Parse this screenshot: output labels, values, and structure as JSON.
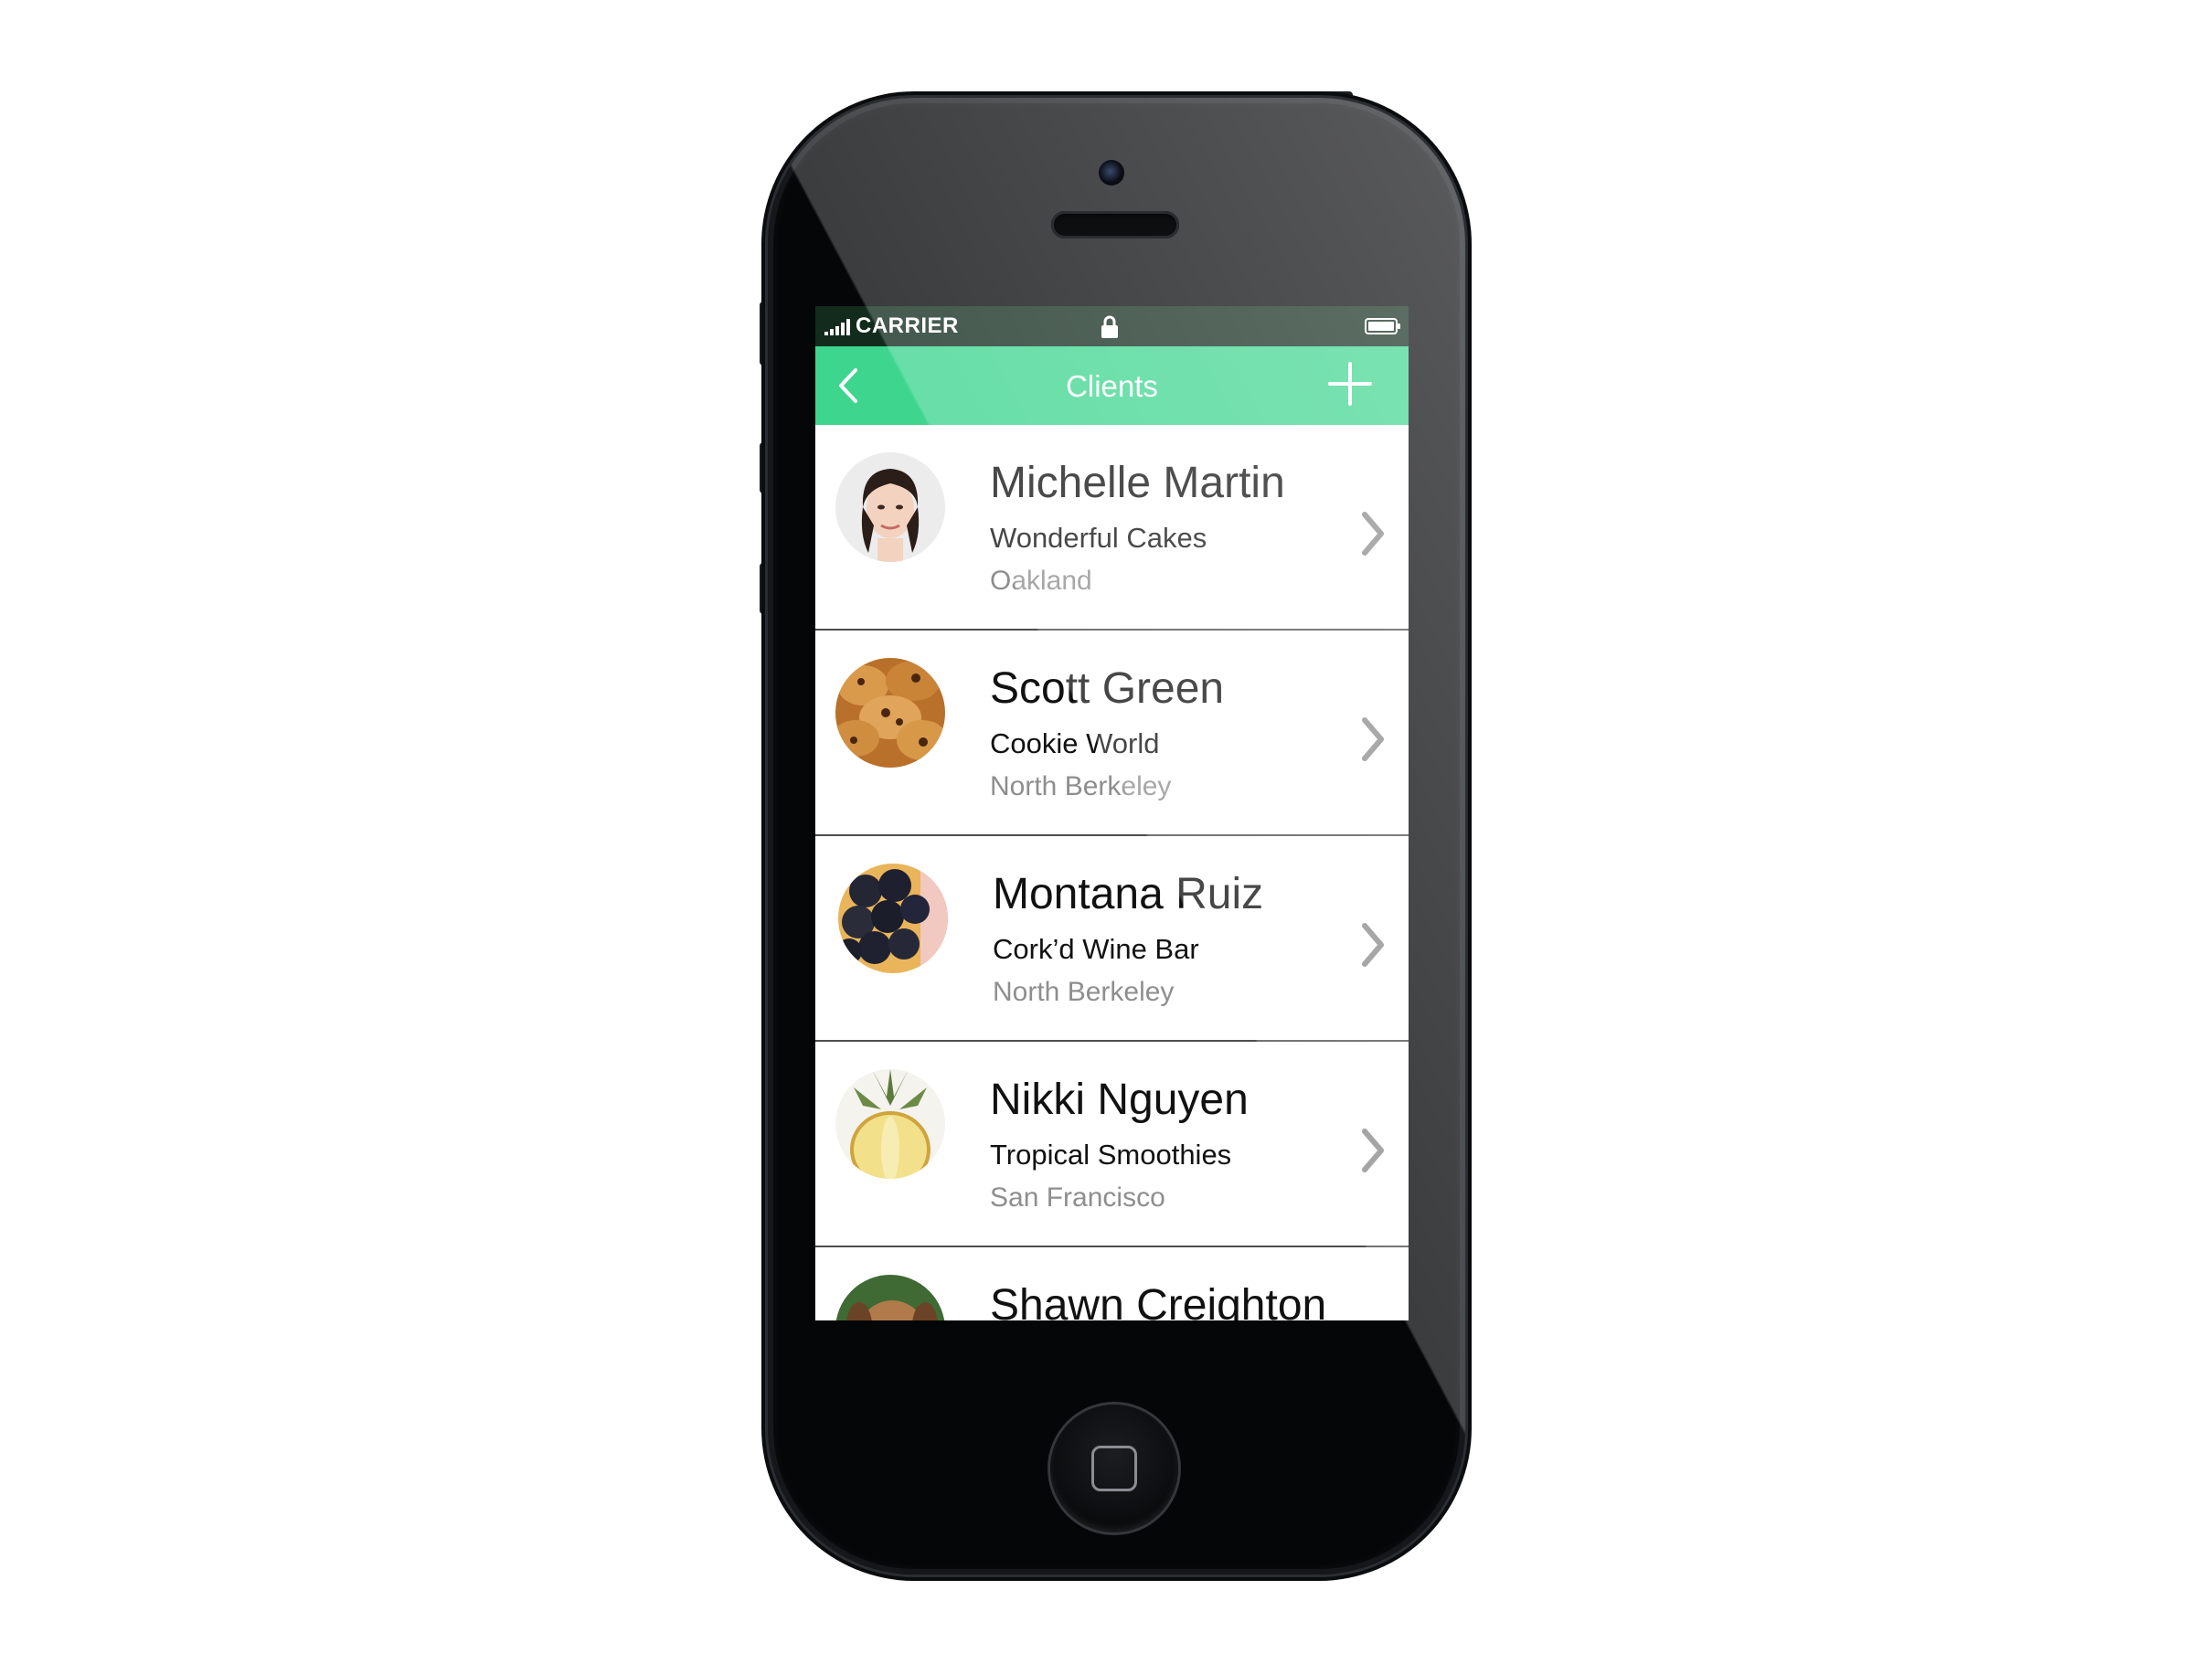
{
  "status_bar": {
    "carrier": "CARRIER",
    "background_color": "#122b1d",
    "icons": [
      "signal-icon",
      "lock-icon",
      "battery-icon"
    ]
  },
  "nav_bar": {
    "title": "Clients",
    "background_color": "#3ed58f",
    "left_icon": "back-chevron-icon",
    "right_icon": "plus-icon"
  },
  "clients": [
    {
      "name": "Michelle Martin",
      "company": "Wonderful Cakes",
      "city": "Oakland",
      "avatar": "woman-portrait"
    },
    {
      "name": "Scott Green",
      "company": "Cookie World",
      "city": "North Berkeley",
      "avatar": "cookies"
    },
    {
      "name": "Montana Ruiz",
      "company": "Cork’d Wine Bar",
      "city": "North Berkeley",
      "avatar": "grapes"
    },
    {
      "name": "Nikki Nguyen",
      "company": "Tropical Smoothies",
      "city": "San Francisco",
      "avatar": "pineapple"
    },
    {
      "name": "Shawn Creighton",
      "company": "",
      "city": "",
      "avatar": "dog"
    }
  ],
  "colors": {
    "accent": "#3ed58f",
    "secondary_text": "#8e8e8e",
    "divider": "#4d4d4d"
  }
}
